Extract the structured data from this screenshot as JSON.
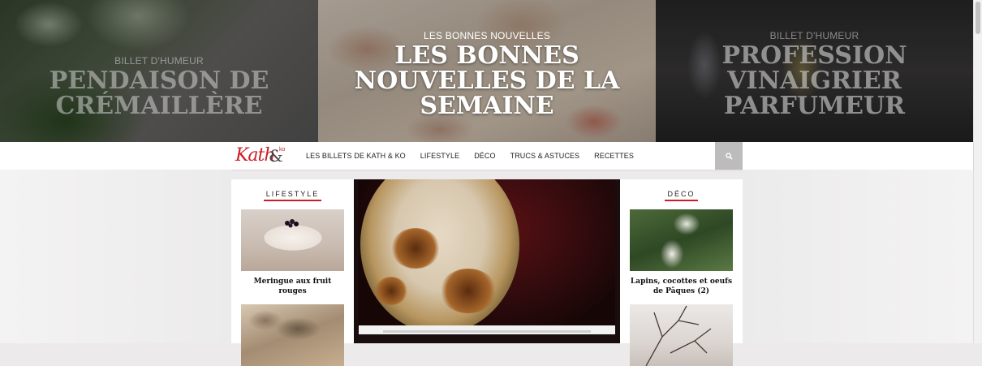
{
  "hero": {
    "slides": [
      {
        "category": "BILLET D'HUMEUR",
        "title_line1": "PENDAISON DE",
        "title_line2": "CRÉMAILLÈRE",
        "title_line3": ""
      },
      {
        "category": "LES BONNES NOUVELLES",
        "title_line1": "LES BONNES",
        "title_line2": "NOUVELLES DE LA",
        "title_line3": "SEMAINE"
      },
      {
        "category": "BILLET D'HUMEUR",
        "title_line1": "PROFESSION",
        "title_line2": "VINAIGRIER",
        "title_line3": "PARFUMEUR"
      }
    ]
  },
  "nav": {
    "logo": {
      "text": "Kath",
      "amp": "&",
      "ko": "ko"
    },
    "items": [
      "LES BILLETS DE KATH & KO",
      "LIFESTYLE",
      "DÉCO",
      "TRUCS & ASTUCES",
      "RECETTES"
    ],
    "search_icon": "search-icon"
  },
  "content": {
    "left": {
      "title": "LIFESTYLE",
      "cards": [
        {
          "caption": "Meringue aux fruit rouges"
        },
        {
          "caption": ""
        }
      ]
    },
    "right": {
      "title": "DÉCO",
      "cards": [
        {
          "caption": "Lapins, cocottes et oeufs de Pâques (2)"
        },
        {
          "caption": ""
        }
      ]
    }
  },
  "colors": {
    "accent": "#c91f28",
    "nav_bg": "#ffffff",
    "search_bg": "#bcbcbc"
  }
}
